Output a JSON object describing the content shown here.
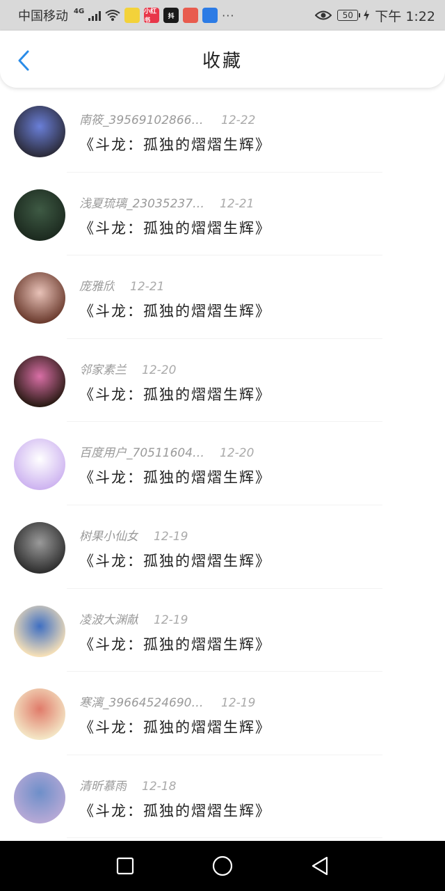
{
  "status_bar": {
    "carrier": "中国移动",
    "network": "4G",
    "battery": "50",
    "time": "下午 1:22",
    "app_icons": [
      {
        "name": "duck-app-icon",
        "color": "#f3d23a",
        "label": ""
      },
      {
        "name": "xiaohongshu-app-icon",
        "color": "#e8374a",
        "label": "小红书"
      },
      {
        "name": "tiktok-app-icon",
        "color": "#1a1a1a",
        "label": "抖"
      },
      {
        "name": "gift-app-icon",
        "color": "#e85b4e",
        "label": ""
      },
      {
        "name": "feishu-app-icon",
        "color": "#2c7be5",
        "label": ""
      }
    ],
    "more": "···"
  },
  "header": {
    "title": "收藏",
    "back_icon": "chevron-left-icon",
    "accent": "#2a8ce8"
  },
  "items": [
    {
      "name": "南筱_395691028666…",
      "date": "12-22",
      "content": "《斗龙：孤独的熠熠生辉》",
      "avatar_colors": [
        "#2b2b3a",
        "#6a7fd8"
      ]
    },
    {
      "name": "浅夏琉璃_23035237…",
      "date": "12-21",
      "content": "《斗龙：孤独的熠熠生辉》",
      "avatar_colors": [
        "#1c2a1f",
        "#3e5a44"
      ]
    },
    {
      "name": "庞雅欣",
      "date": "12-21",
      "content": "《斗龙：孤独的熠熠生辉》",
      "avatar_colors": [
        "#6b3b2e",
        "#e8c2b8"
      ]
    },
    {
      "name": "邻家素兰",
      "date": "12-20",
      "content": "《斗龙：孤独的熠熠生辉》",
      "avatar_colors": [
        "#2a1a14",
        "#d96fa6"
      ]
    },
    {
      "name": "百度用户_70511604…",
      "date": "12-20",
      "content": "《斗龙：孤独的熠熠生辉》",
      "avatar_colors": [
        "#cdb3f0",
        "#ffffff"
      ]
    },
    {
      "name": "树果小仙女",
      "date": "12-19",
      "content": "《斗龙：孤独的熠熠生辉》",
      "avatar_colors": [
        "#2e2e2e",
        "#9a9a9a"
      ]
    },
    {
      "name": "凌波大渊献",
      "date": "12-19",
      "content": "《斗龙：孤独的熠熠生辉》",
      "avatar_colors": [
        "#f7e1b8",
        "#3f6fc2"
      ]
    },
    {
      "name": "寒漓_396645246900…",
      "date": "12-19",
      "content": "《斗龙：孤独的熠熠生辉》",
      "avatar_colors": [
        "#f4e7c6",
        "#e07b6a"
      ]
    },
    {
      "name": "清昕慕雨",
      "date": "12-18",
      "content": "《斗龙：孤独的熠熠生辉》",
      "avatar_colors": [
        "#b7a9d6",
        "#6e8fc9"
      ]
    }
  ],
  "nav_bar": {
    "recent_icon": "square-icon",
    "home_icon": "circle-icon",
    "back_icon": "triangle-back-icon"
  }
}
